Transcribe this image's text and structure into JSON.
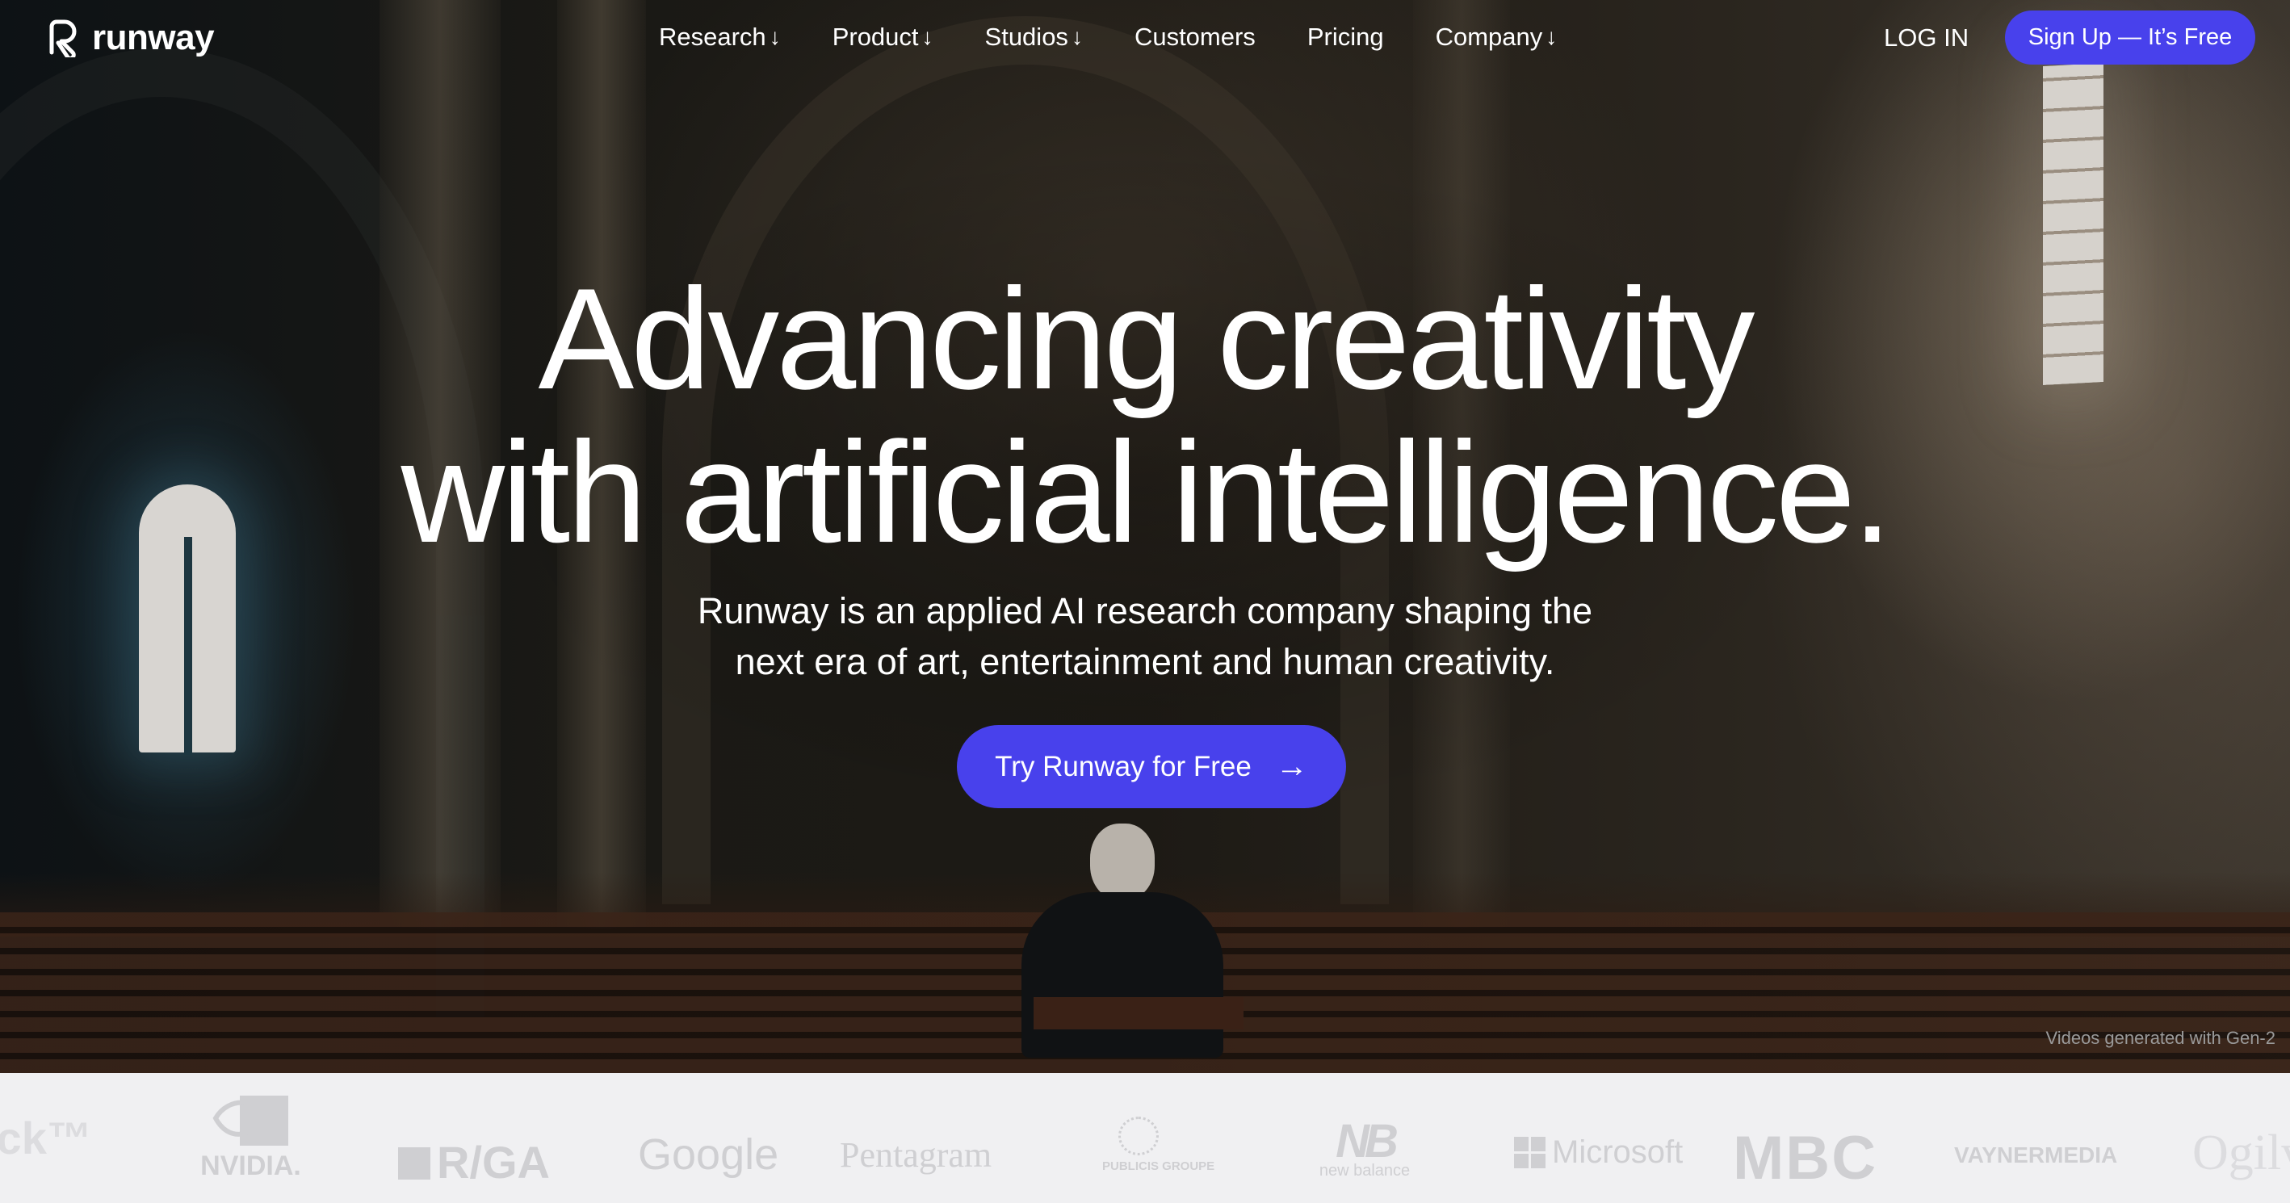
{
  "brand": {
    "name": "runway",
    "logo_icon": "runway-r-icon"
  },
  "nav": {
    "links": [
      {
        "label": "Research",
        "has_dropdown": true
      },
      {
        "label": "Product",
        "has_dropdown": true
      },
      {
        "label": "Studios",
        "has_dropdown": true
      },
      {
        "label": "Customers",
        "has_dropdown": false
      },
      {
        "label": "Pricing",
        "has_dropdown": false
      },
      {
        "label": "Company",
        "has_dropdown": true
      }
    ],
    "dropdown_arrow": "↓",
    "login_label": "LOG IN",
    "signup_label": "Sign Up — It’s Free"
  },
  "hero": {
    "headline_line1": "Advancing creativity",
    "headline_line2": "with artificial intelligence.",
    "subtitle_line1": "Runway is an applied AI research company shaping the",
    "subtitle_line2": "next era of art, entertainment and human creativity.",
    "cta_label": "Try Runway for Free",
    "cta_arrow": "→",
    "credit": "Videos generated with Gen-2"
  },
  "customers": {
    "logos": [
      "ick™",
      "NVIDIA.",
      "R/GA",
      "Google",
      "Pentagram",
      "PUBLICIS GROUPE",
      "new balance",
      "Microsoft",
      "MBC",
      "VAYNERMEDIA",
      "Ogilvy"
    ]
  },
  "colors": {
    "accent": "#4841ec",
    "logo_strip_bg": "#f0f0f2",
    "logo_gray": "#cfcfd2"
  }
}
